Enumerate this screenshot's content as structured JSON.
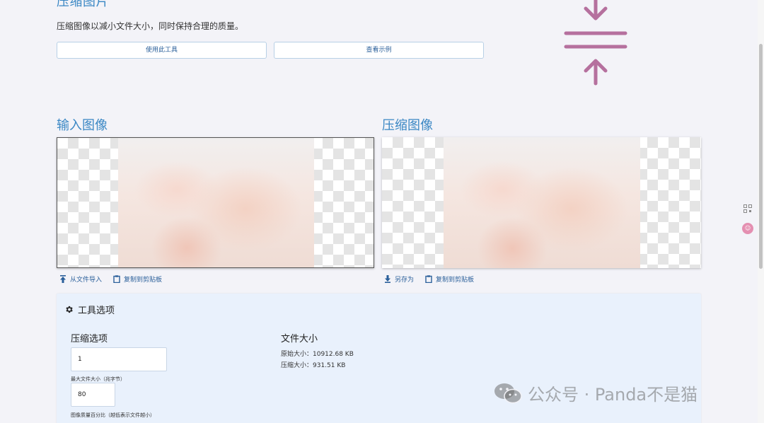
{
  "hero": {
    "title": "压缩图片",
    "description": "压缩图像以减小文件大小，同时保持合理的质量。",
    "use_tool_label": "使用此工具",
    "view_example_label": "查看示例"
  },
  "input_section": {
    "title": "输入图像",
    "import_label": "从文件导入",
    "copy_label": "复制到剪贴板"
  },
  "output_section": {
    "title": "压缩图像",
    "save_as_label": "另存为",
    "copy_label": "复制到剪贴板"
  },
  "options": {
    "title": "工具选项",
    "compress_options_title": "压缩选项",
    "max_size_value": "1",
    "max_size_label": "最大文件大小（兆字节）",
    "quality_value": "80",
    "quality_label": "图像质量百分比（越低表示文件越小）",
    "file_size_title": "文件大小",
    "original_size": "原始大小：10912.68 KB",
    "compressed_size": "压缩大小：931.51 KB"
  },
  "watermark": {
    "text": "公众号 · Panda不是猫"
  },
  "colors": {
    "accent": "#3a87c4",
    "icon_purple": "#b5709e",
    "card_bg": "#e9f1fc"
  },
  "icons": {
    "hero": "compress-arrows-icon",
    "import": "upload-icon",
    "copy": "clipboard-icon",
    "save": "download-icon",
    "options": "gear-icon"
  }
}
